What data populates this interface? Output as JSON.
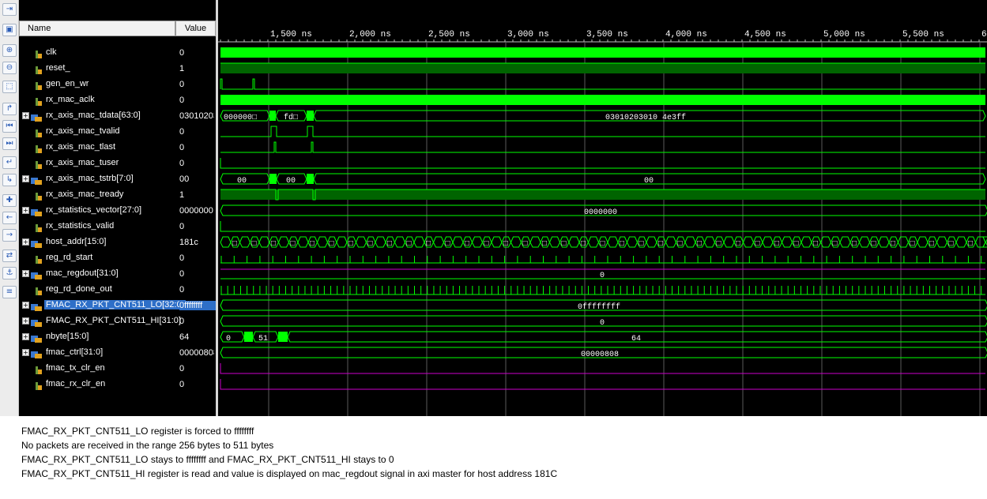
{
  "toolbar": {
    "buttons": [
      {
        "name": "step-in-icon",
        "glyph": "⇥"
      },
      {
        "name": "save-icon",
        "glyph": "▣"
      },
      {
        "name": "zoom-in-icon",
        "glyph": "⊕"
      },
      {
        "name": "zoom-out-icon",
        "glyph": "⊖"
      },
      {
        "name": "zoom-fit-icon",
        "glyph": "⬚"
      },
      {
        "name": "cursor-icon",
        "glyph": "↱"
      },
      {
        "name": "go-to-start-icon",
        "glyph": "⏮"
      },
      {
        "name": "go-to-end-icon",
        "glyph": "⏭"
      },
      {
        "name": "previous-transition-icon",
        "glyph": "↵"
      },
      {
        "name": "next-transition-icon",
        "glyph": "↳"
      },
      {
        "name": "add-marker-icon",
        "glyph": "✚"
      },
      {
        "name": "previous-marker-icon",
        "glyph": "←"
      },
      {
        "name": "next-marker-icon",
        "glyph": "→"
      },
      {
        "name": "swap-cursors-icon",
        "glyph": "⇄"
      },
      {
        "name": "snap-icon",
        "glyph": "⚓"
      },
      {
        "name": "expand-icon",
        "glyph": "≡"
      }
    ]
  },
  "columns": {
    "name": "Name",
    "value": "Value"
  },
  "ruler": {
    "labels": [
      "1,500 ns",
      "2,000 ns",
      "2,500 ns",
      "3,000 ns",
      "3,500 ns",
      "4,000 ns",
      "4,500 ns",
      "5,000 ns",
      "5,500 ns",
      "6"
    ]
  },
  "signals": [
    {
      "name": "clk",
      "value": "0",
      "bus": false
    },
    {
      "name": "reset_",
      "value": "1",
      "bus": false
    },
    {
      "name": "gen_en_wr",
      "value": "0",
      "bus": false
    },
    {
      "name": "rx_mac_aclk",
      "value": "0",
      "bus": false
    },
    {
      "name": "rx_axis_mac_tdata[63:0]",
      "value": "03010203",
      "bus": true
    },
    {
      "name": "rx_axis_mac_tvalid",
      "value": "0",
      "bus": false
    },
    {
      "name": "rx_axis_mac_tlast",
      "value": "0",
      "bus": false
    },
    {
      "name": "rx_axis_mac_tuser",
      "value": "0",
      "bus": false
    },
    {
      "name": "rx_axis_mac_tstrb[7:0]",
      "value": "00",
      "bus": true
    },
    {
      "name": "rx_axis_mac_tready",
      "value": "1",
      "bus": false
    },
    {
      "name": "rx_statistics_vector[27:0]",
      "value": "0000000",
      "bus": true
    },
    {
      "name": "rx_statistics_valid",
      "value": "0",
      "bus": false
    },
    {
      "name": "host_addr[15:0]",
      "value": "181c",
      "bus": true
    },
    {
      "name": "reg_rd_start",
      "value": "0",
      "bus": false
    },
    {
      "name": "mac_regdout[31:0]",
      "value": "0",
      "bus": true
    },
    {
      "name": "reg_rd_done_out",
      "value": "0",
      "bus": false
    },
    {
      "name": "FMAC_RX_PKT_CNT511_LO[32:0]",
      "value": "0ffffffff",
      "bus": true,
      "selected": true
    },
    {
      "name": "FMAC_RX_PKT_CNT511_HI[31:0]",
      "value": "0",
      "bus": true
    },
    {
      "name": "nbyte[15:0]",
      "value": "64",
      "bus": true
    },
    {
      "name": "fmac_ctrl[31:0]",
      "value": "00000808",
      "bus": true
    },
    {
      "name": "fmac_tx_clr_en",
      "value": "0",
      "bus": false
    },
    {
      "name": "fmac_rx_clr_en",
      "value": "0",
      "bus": false
    }
  ],
  "wave_text": {
    "tdata_a": "000000□",
    "tdata_b": "fd□",
    "tdata_c": "03010203010 4e3ff",
    "tstrb_a": "00",
    "tstrb_b": "00",
    "tstrb_c": "00",
    "stats": "0000000",
    "host_addr_seg": "□",
    "regdout": "0",
    "cnt_lo": "0ffffffff",
    "cnt_hi": "0",
    "nbyte_a": "0",
    "nbyte_b": "51",
    "nbyte_c": "64",
    "fmac_ctrl": "00000808"
  },
  "colors": {
    "green": "#00ff00",
    "dark_green": "#006400",
    "magenta": "#cc00cc",
    "grid": "#5a5a5a",
    "bg": "#000000"
  },
  "captions": [
    "FMAC_RX_PKT_CNT511_LO register is forced to ffffffff",
    "No packets are received in the range 256 bytes to 511 bytes",
    "FMAC_RX_PKT_CNT511_LO stays to ffffffff and FMAC_RX_PKT_CNT511_HI stays to 0",
    "FMAC_RX_PKT_CNT511_HI register is read and value is displayed on mac_regdout signal in axi master for host address 181C"
  ]
}
